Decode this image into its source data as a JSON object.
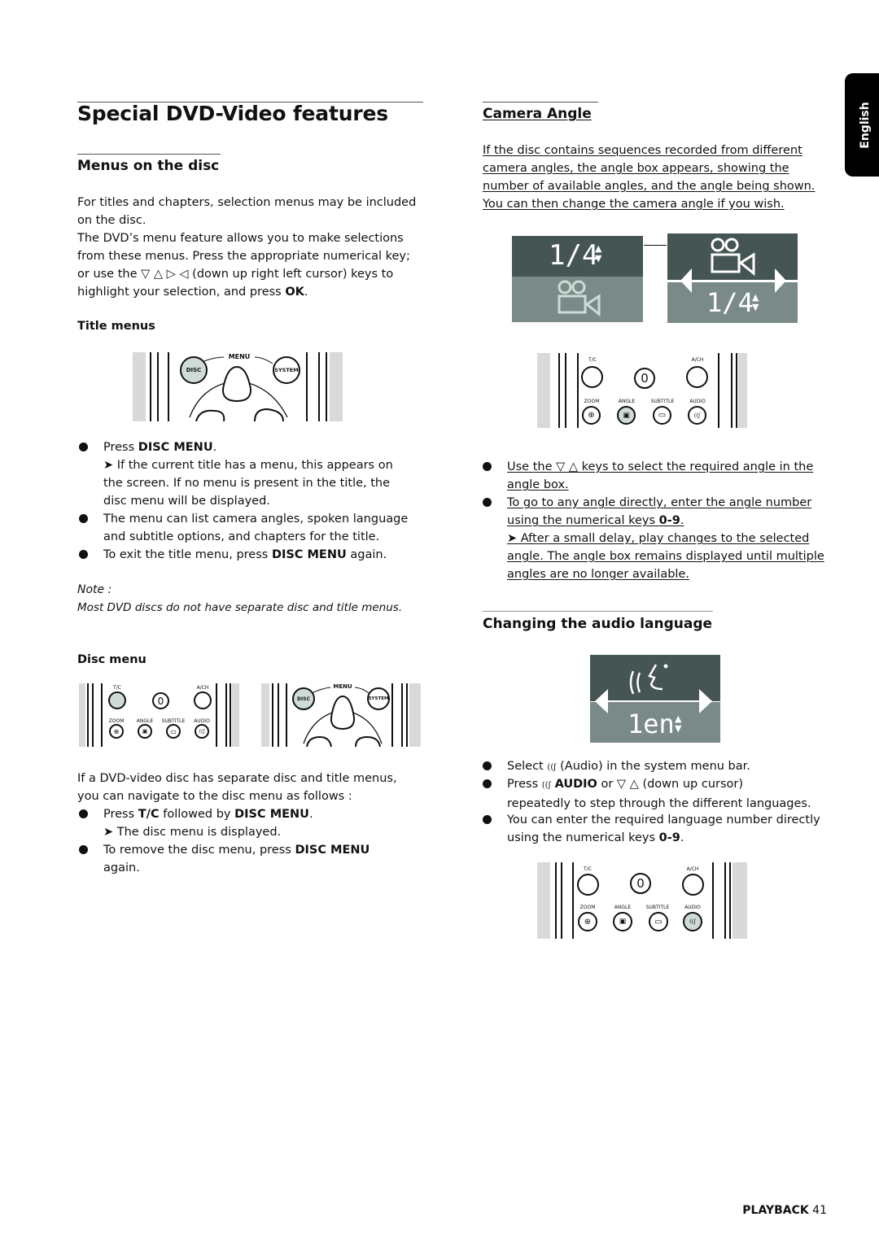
{
  "side_tab": {
    "label": "English"
  },
  "left": {
    "title": "Special DVD-Video features",
    "menus": {
      "heading": "Menus on the disc",
      "intro_lines": [
        "For titles and chapters, selection menus may be included",
        "on the disc."
      ],
      "para2_lines": [
        "The DVD’s menu feature allows you to make selections",
        "from these menus. Press the appropriate numerical key;",
        "or use the ▽ △ ▷ ◁ (down up right left cursor) keys to"
      ],
      "para2_last_prefix": "highlight your selection, and press ",
      "para2_last_bold": "OK",
      "para2_last_suffix": "."
    },
    "title_menus": {
      "heading": "Title menus",
      "remote": {
        "menu": "MENU",
        "disc": "DISC",
        "system": "SYSTEM"
      },
      "bullets": [
        {
          "prefix": "Press ",
          "bold": "DISC MENU",
          "suffix": ".",
          "result_lines": [
            "➤  If the current title has a menu, this appears on",
            "the screen. If no menu is present in the title, the",
            "disc menu will be displayed."
          ]
        },
        {
          "lines": [
            "The menu can list camera angles, spoken language",
            "and subtitle options, and chapters for the title."
          ]
        },
        {
          "prefix": "To exit the title menu, press ",
          "bold": "DISC MENU",
          "suffix": " again."
        }
      ],
      "note_label": "Note :",
      "note_text": "Most DVD discs do not have separate disc and title menus."
    },
    "disc_menu": {
      "heading": "Disc menu",
      "remote_keys": {
        "tc": "T/C",
        "zero": "0",
        "ach": "A/CH",
        "zoom": "ZOOM",
        "angle": "ANGLE",
        "subtitle": "SUBTITLE",
        "audio": "AUDIO"
      },
      "remote_menu": {
        "menu": "MENU",
        "disc": "DISC",
        "system": "SYSTEM"
      },
      "intro_lines": [
        "If a DVD-video disc has separate disc and title menus,",
        "you can navigate to the disc menu as follows :"
      ],
      "bullet1": {
        "p1": "Press ",
        "b1": "T/C",
        "p2": " followed by ",
        "b2": "DISC MENU",
        "p3": ".",
        "result": "➤  The disc menu is displayed."
      },
      "bullet2": {
        "prefix": "To remove the disc menu, press ",
        "bold": "DISC MENU",
        "line2": "again."
      }
    }
  },
  "right": {
    "camera": {
      "heading": "Camera Angle",
      "intro_lines": [
        "If the disc contains sequences recorded from different",
        "camera angles, the angle box appears, showing the",
        "number of available angles, and the angle being shown.",
        "You can then change the camera angle if you wish."
      ],
      "osd_value": "1/4",
      "remote_keys": {
        "tc": "T/C",
        "zero": "0",
        "ach": "A/CH",
        "zoom": "ZOOM",
        "angle": "ANGLE",
        "subtitle": "SUBTITLE",
        "audio": "AUDIO"
      },
      "bullets": [
        {
          "lines": [
            "Use the ▽ △ keys to select the required angle in the",
            "angle box."
          ]
        },
        {
          "line1": "To go to any angle directly, enter the angle number",
          "line2_prefix": "using the numerical keys ",
          "line2_bold": "0-9",
          "line2_suffix": ".",
          "result_lines": [
            "➤  After a small delay, play changes to the selected",
            "angle. The angle box remains displayed until multiple",
            "angles are no longer available."
          ]
        }
      ]
    },
    "audio": {
      "heading": "Changing the audio language",
      "osd_value": "1en",
      "bullets": [
        {
          "prefix": "Select ",
          "icon": "((ʃ",
          "suffix": " (Audio) in the system menu bar."
        },
        {
          "prefix": "Press ",
          "bold": "AUDIO",
          "suffix": " or ▽ △ (down up cursor)",
          "line2": "repeatedly to step through the different languages."
        },
        {
          "line1": "You can enter the required language number directly",
          "line2_prefix": "using the numerical keys ",
          "line2_bold": "0-9",
          "line2_suffix": "."
        }
      ],
      "remote_keys": {
        "tc": "T/C",
        "zero": "0",
        "ach": "A/CH",
        "zoom": "ZOOM",
        "angle": "ANGLE",
        "subtitle": "SUBTITLE",
        "audio": "AUDIO"
      }
    }
  },
  "footer": {
    "section": "PLAYBACK",
    "page": "41"
  },
  "colors": {
    "highlight_button": "#cfdcd6",
    "osd_dark": "#455553",
    "osd_light": "#7a8a88"
  }
}
